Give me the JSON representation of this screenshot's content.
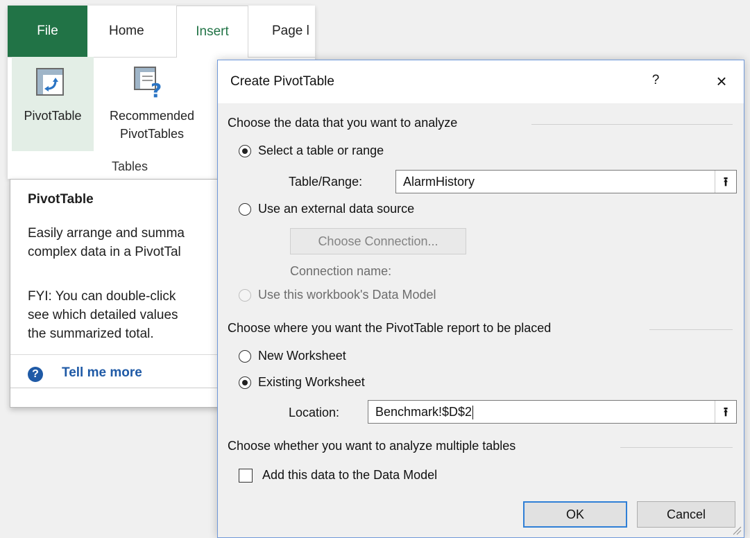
{
  "ribbon": {
    "tabs": [
      "File",
      "Home",
      "Insert",
      "Page l"
    ],
    "commands": {
      "pivottable": "PivotTable",
      "recommended_line1": "Recommended",
      "recommended_line2": "PivotTables"
    },
    "group_label": "Tables"
  },
  "tooltip": {
    "title": "PivotTable",
    "text1": "Easily arrange and summa\ncomplex data in a PivotTal",
    "text2": "FYI: You can double-click\nsee which detailed values\nthe summarized total.",
    "tell_me_more": "Tell me more"
  },
  "dialog": {
    "title": "Create PivotTable",
    "help": "?",
    "close": "×",
    "section1": "Choose the data that you want to analyze",
    "select_table": "Select a table or range",
    "table_range_label": "Table/Range:",
    "table_range_value": "AlarmHistory",
    "use_external": "Use an external data source",
    "choose_connection": "Choose Connection...",
    "connection_name": "Connection name:",
    "use_data_model": "Use this workbook's Data Model",
    "section2": "Choose where you want the PivotTable report to be placed",
    "new_worksheet": "New Worksheet",
    "existing_worksheet": "Existing Worksheet",
    "location_label": "Location:",
    "location_value": "Benchmark!$D$2",
    "section3": "Choose whether you want to analyze multiple tables",
    "add_data_model": "Add this data to the Data Model",
    "ok": "OK",
    "cancel": "Cancel",
    "collapse_icon": "⭱"
  }
}
